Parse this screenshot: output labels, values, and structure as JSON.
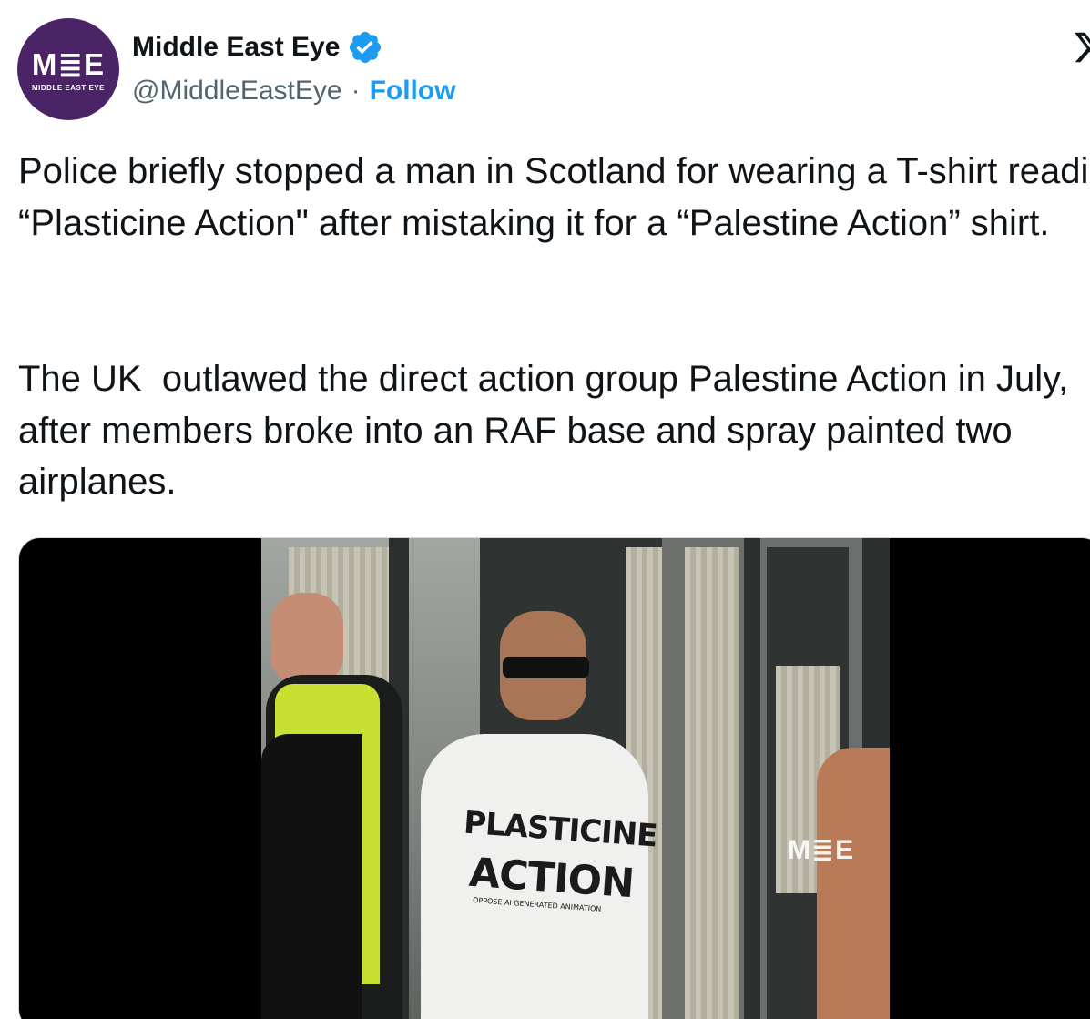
{
  "author": {
    "avatar_text": "M≣E",
    "avatar_subtext": "MIDDLE EAST EYE",
    "name": "Middle East Eye",
    "verified_icon": "verified-badge-icon",
    "handle": "@MiddleEastEye",
    "separator": "·",
    "follow_label": "Follow"
  },
  "tweet": {
    "paragraph_1": "Police briefly stopped a man in Scotland for wearing a T-shirt reading “Plasticine Action\" after mistaking it for a “Palestine Action” shirt.",
    "paragraph_2": "The UK  outlawed the direct action group Palestine Action in July, after members broke into an RAF base and spray painted two airplanes."
  },
  "media": {
    "watermark": "M≣E",
    "shirt_line_1": "PLASTICINE",
    "shirt_line_2": "ACTION",
    "shirt_small_text": "OPPOSE AI GENERATED ANIMATION"
  },
  "colors": {
    "accent": "#1d9bf0",
    "text": "#0f1419",
    "secondary": "#536471",
    "avatar_bg": "#4b2468"
  }
}
